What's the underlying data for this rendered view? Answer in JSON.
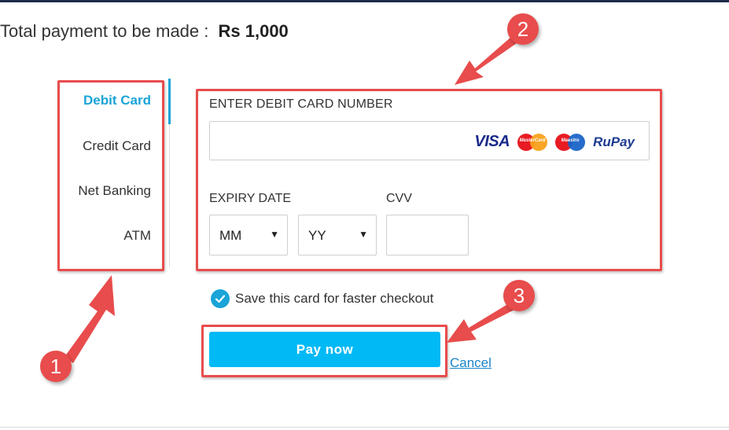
{
  "summary": {
    "label": "Total payment to be made :",
    "amount": "Rs 1,000"
  },
  "tabs": [
    {
      "label": "Debit Card",
      "active": true
    },
    {
      "label": "Credit Card",
      "active": false
    },
    {
      "label": "Net Banking",
      "active": false
    },
    {
      "label": "ATM",
      "active": false
    }
  ],
  "card_form": {
    "card_number_label": "ENTER DEBIT CARD NUMBER",
    "card_number_value": "",
    "logos": {
      "visa": "VISA",
      "mastercard": "MasterCard",
      "maestro": "Maestro",
      "rupay": "RuPay"
    },
    "expiry_label": "EXPIRY DATE",
    "month_selected": "MM",
    "year_selected": "YY",
    "cvv_label": "CVV",
    "cvv_value": ""
  },
  "save_card": {
    "label": "Save this card for faster checkout",
    "checked": true
  },
  "actions": {
    "pay_label": "Pay now",
    "cancel_label": "Cancel"
  },
  "annotations": {
    "badge_1": "1",
    "badge_2": "2",
    "badge_3": "3",
    "color": "#e84c4c"
  },
  "colors": {
    "accent": "#1aa4d8",
    "pay_button": "#00b9f5",
    "link": "#1a84c8"
  }
}
